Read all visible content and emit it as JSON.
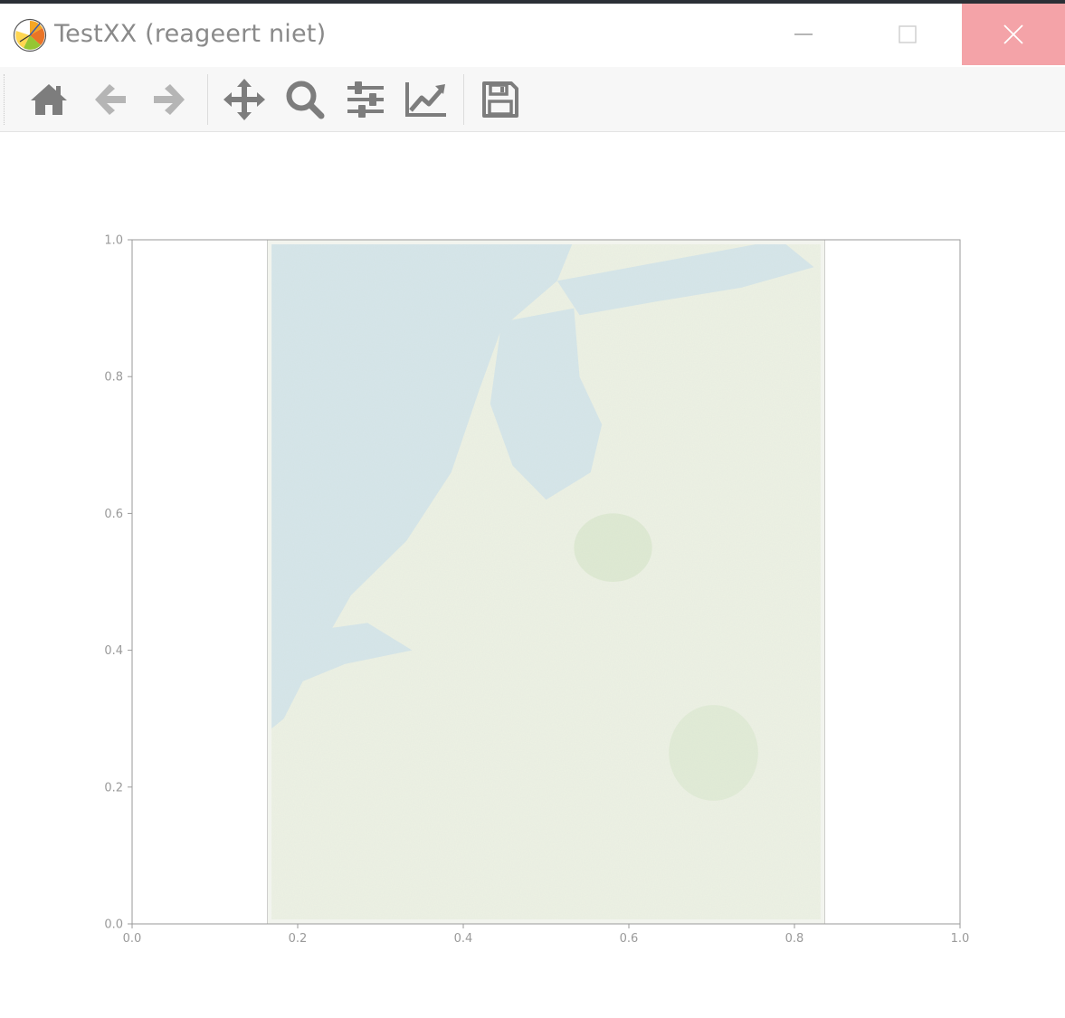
{
  "window": {
    "title": "TestXX (reageert niet)",
    "app_icon": "python-logo-icon",
    "controls": {
      "minimize": "minimize-icon",
      "maximize": "maximize-icon",
      "close": "close-icon"
    },
    "close_hover_color": "#f4a3a8"
  },
  "toolbar": {
    "buttons": [
      {
        "name": "home-button",
        "icon": "home-icon"
      },
      {
        "name": "back-button",
        "icon": "arrow-left-icon"
      },
      {
        "name": "forward-button",
        "icon": "arrow-right-icon"
      },
      {
        "name": "pan-button",
        "icon": "move-icon"
      },
      {
        "name": "zoom-button",
        "icon": "search-icon"
      },
      {
        "name": "subplots-button",
        "icon": "sliders-icon"
      },
      {
        "name": "edit-axis-button",
        "icon": "line-chart-icon"
      },
      {
        "name": "save-button",
        "icon": "floppy-disk-icon"
      }
    ]
  },
  "chart_data": {
    "type": "image",
    "xlim": [
      0.0,
      1.0
    ],
    "ylim": [
      0.0,
      1.0
    ],
    "x_ticks": [
      "0.0",
      "0.2",
      "0.4",
      "0.6",
      "0.8",
      "1.0"
    ],
    "y_ticks": [
      "0.0",
      "0.2",
      "0.4",
      "0.6",
      "0.8",
      "1.0"
    ],
    "image_extent": [
      0.163,
      0.837,
      0.0,
      1.0
    ],
    "image_content": "map of the Netherlands",
    "grid": false
  }
}
